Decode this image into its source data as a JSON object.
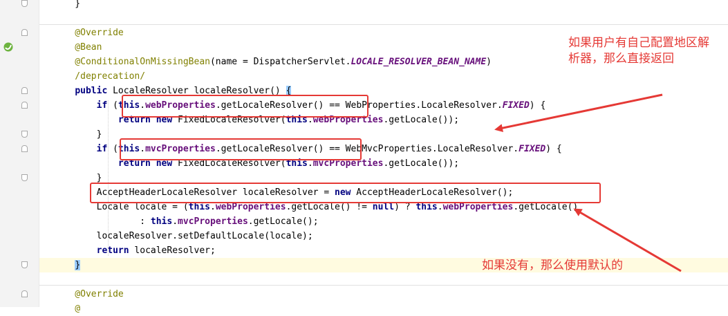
{
  "editor": {
    "lines": [
      {
        "segments": [
          {
            "t": "    }",
            "c": ""
          }
        ]
      },
      {
        "segments": []
      },
      {
        "segments": [
          {
            "t": "    @Override",
            "c": "ann"
          }
        ]
      },
      {
        "segments": [
          {
            "t": "    @Bean",
            "c": "ann"
          }
        ]
      },
      {
        "segments": [
          {
            "t": "    @ConditionalOnMissingBean",
            "c": "ann"
          },
          {
            "t": "(name = DispatcherServlet.",
            "c": ""
          },
          {
            "t": "LOCALE_RESOLVER_BEAN_NAME",
            "c": "cst"
          },
          {
            "t": ")",
            "c": ""
          }
        ]
      },
      {
        "segments": [
          {
            "t": "    /deprecation/",
            "c": "ann"
          }
        ]
      },
      {
        "segments": [
          {
            "t": "    ",
            "c": ""
          },
          {
            "t": "public",
            "c": "kw"
          },
          {
            "t": " LocaleResolver localeResolver() ",
            "c": ""
          },
          {
            "t": "{",
            "c": "brace-hl"
          }
        ]
      },
      {
        "segments": [
          {
            "t": "        ",
            "c": ""
          },
          {
            "t": "if",
            "c": "kw"
          },
          {
            "t": " (",
            "c": ""
          },
          {
            "t": "this",
            "c": "kw"
          },
          {
            "t": ".",
            "c": ""
          },
          {
            "t": "webProperties",
            "c": "fld"
          },
          {
            "t": ".getLocaleResolver() == WebProperties.LocaleResolver.",
            "c": ""
          },
          {
            "t": "FIXED",
            "c": "cst"
          },
          {
            "t": ") {",
            "c": ""
          }
        ]
      },
      {
        "segments": [
          {
            "t": "            ",
            "c": ""
          },
          {
            "t": "return new",
            "c": "kw"
          },
          {
            "t": " FixedLocaleResolver(",
            "c": ""
          },
          {
            "t": "this",
            "c": "kw"
          },
          {
            "t": ".",
            "c": ""
          },
          {
            "t": "webProperties",
            "c": "fld"
          },
          {
            "t": ".getLocale());",
            "c": ""
          }
        ]
      },
      {
        "segments": [
          {
            "t": "        }",
            "c": ""
          }
        ]
      },
      {
        "segments": [
          {
            "t": "        ",
            "c": ""
          },
          {
            "t": "if",
            "c": "kw"
          },
          {
            "t": " (",
            "c": ""
          },
          {
            "t": "this",
            "c": "kw"
          },
          {
            "t": ".",
            "c": ""
          },
          {
            "t": "mvcProperties",
            "c": "fld"
          },
          {
            "t": ".getLocaleResolver() == WebMvcProperties.LocaleResolver.",
            "c": ""
          },
          {
            "t": "FIXED",
            "c": "cst"
          },
          {
            "t": ") {",
            "c": ""
          }
        ]
      },
      {
        "segments": [
          {
            "t": "            ",
            "c": ""
          },
          {
            "t": "return new",
            "c": "kw"
          },
          {
            "t": " FixedLocaleResolver(",
            "c": ""
          },
          {
            "t": "this",
            "c": "kw"
          },
          {
            "t": ".",
            "c": ""
          },
          {
            "t": "mvcProperties",
            "c": "fld"
          },
          {
            "t": ".getLocale());",
            "c": ""
          }
        ]
      },
      {
        "segments": [
          {
            "t": "        }",
            "c": ""
          }
        ]
      },
      {
        "segments": [
          {
            "t": "        AcceptHeaderLocaleResolver localeResolver = ",
            "c": ""
          },
          {
            "t": "new",
            "c": "kw"
          },
          {
            "t": " AcceptHeaderLocaleResolver();",
            "c": ""
          }
        ]
      },
      {
        "segments": [
          {
            "t": "        Locale locale = (",
            "c": ""
          },
          {
            "t": "this",
            "c": "kw"
          },
          {
            "t": ".",
            "c": ""
          },
          {
            "t": "webProperties",
            "c": "fld"
          },
          {
            "t": ".getLocale() != ",
            "c": ""
          },
          {
            "t": "null",
            "c": "kw"
          },
          {
            "t": ") ? ",
            "c": ""
          },
          {
            "t": "this",
            "c": "kw"
          },
          {
            "t": ".",
            "c": ""
          },
          {
            "t": "webProperties",
            "c": "fld"
          },
          {
            "t": ".getLocale()",
            "c": ""
          }
        ]
      },
      {
        "segments": [
          {
            "t": "                : ",
            "c": ""
          },
          {
            "t": "this",
            "c": "kw"
          },
          {
            "t": ".",
            "c": ""
          },
          {
            "t": "mvcProperties",
            "c": "fld"
          },
          {
            "t": ".getLocale();",
            "c": ""
          }
        ]
      },
      {
        "segments": [
          {
            "t": "        localeResolver.setDefaultLocale(locale);",
            "c": ""
          }
        ]
      },
      {
        "segments": [
          {
            "t": "        ",
            "c": ""
          },
          {
            "t": "return",
            "c": "kw"
          },
          {
            "t": " localeResolver;",
            "c": ""
          }
        ]
      },
      {
        "segments": [
          {
            "t": "    ",
            "c": ""
          },
          {
            "t": "}",
            "c": "brace-hl"
          }
        ]
      },
      {
        "segments": []
      },
      {
        "segments": [
          {
            "t": "    @Override",
            "c": "ann"
          }
        ]
      },
      {
        "segments": [
          {
            "t": "    @",
            "c": "ann"
          }
        ]
      }
    ]
  },
  "annotations": {
    "note_top": "如果用户有自己配置地区解析器，那么直接返回",
    "note_bottom": "如果没有，那么使用默认的"
  }
}
